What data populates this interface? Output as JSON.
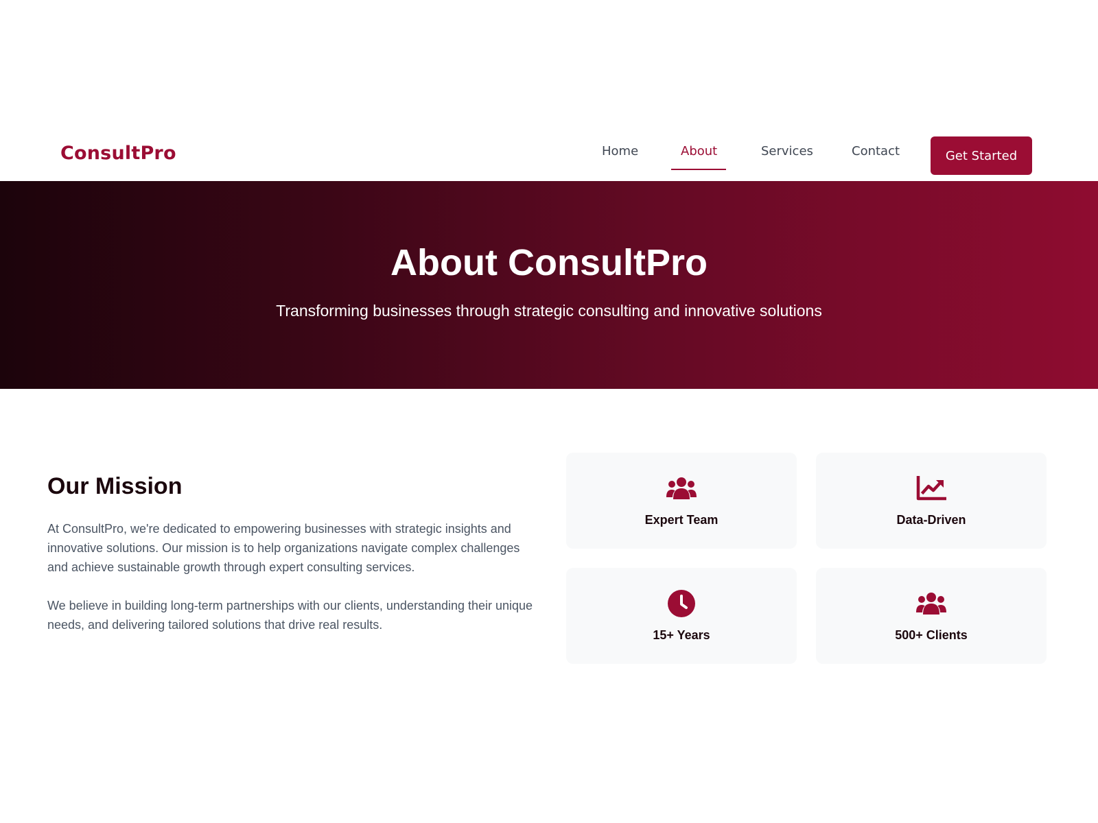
{
  "brand": {
    "name": "ConsultPro",
    "accent": "#9b0d34"
  },
  "nav": {
    "links": [
      {
        "label": "Home"
      },
      {
        "label": "About",
        "active": true
      },
      {
        "label": "Services"
      },
      {
        "label": "Contact"
      }
    ],
    "cta_label": "Get Started"
  },
  "hero": {
    "title": "About ConsultPro",
    "subtitle": "Transforming businesses through strategic consulting and innovative solutions"
  },
  "mission": {
    "title": "Our Mission",
    "paragraphs": [
      "At ConsultPro, we're dedicated to empowering businesses with strategic insights and innovative solutions. Our mission is to help organizations navigate complex challenges and achieve sustainable growth through expert consulting services.",
      "We believe in building long-term partnerships with our clients, understanding their unique needs, and delivering tailored solutions that drive real results."
    ]
  },
  "features": [
    {
      "label": "Expert Team",
      "icon": "users-icon"
    },
    {
      "label": "Data-Driven",
      "icon": "chart-line-icon"
    },
    {
      "label": "15+ Years",
      "icon": "clock-icon"
    },
    {
      "label": "500+ Clients",
      "icon": "users-icon"
    }
  ]
}
